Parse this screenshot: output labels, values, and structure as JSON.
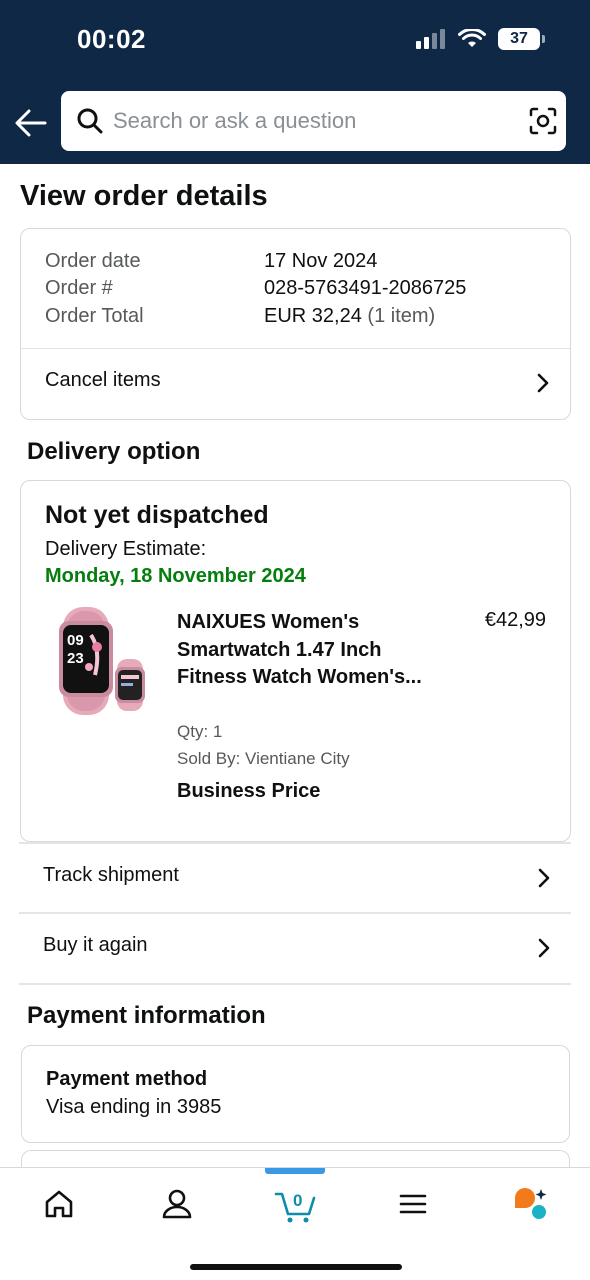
{
  "status_bar": {
    "time": "00:02",
    "battery": "37"
  },
  "search": {
    "placeholder": "Search or ask a question"
  },
  "page_title": "View order details",
  "order_summary": {
    "date_label": "Order date",
    "date_value": "17 Nov 2024",
    "number_label": "Order #",
    "number_value": "028-5763491-2086725",
    "total_label": "Order Total",
    "total_value": "EUR 32,24",
    "total_items": "(1 item)",
    "cancel_label": "Cancel items"
  },
  "delivery": {
    "section_title": "Delivery option",
    "status": "Not yet dispatched",
    "estimate_label": "Delivery Estimate:",
    "estimate_date": "Monday, 18 November 2024",
    "product": {
      "title": "NAIXUES Women's Smartwatch 1.47 Inch Fitness Watch Women's...",
      "price": "€42,99",
      "qty": "Qty: 1",
      "seller": "Sold By: Vientiane City",
      "badge": "Business Price",
      "watch_time_h": "09",
      "watch_time_m": "23"
    }
  },
  "actions": {
    "track_label": "Track shipment",
    "buy_again_label": "Buy it again"
  },
  "payment": {
    "section_title": "Payment information",
    "method_title": "Payment method",
    "method_text": "Visa  ending in 3985"
  },
  "bottom_nav": {
    "cart_count": "0",
    "active_tab": "cart",
    "active_color": "#0e8cac"
  },
  "colors": {
    "header_bg": "#0e2846",
    "delivery_green": "#067d0f",
    "rufus_orange": "#f27a1a",
    "rufus_teal": "#1bb2c8"
  }
}
